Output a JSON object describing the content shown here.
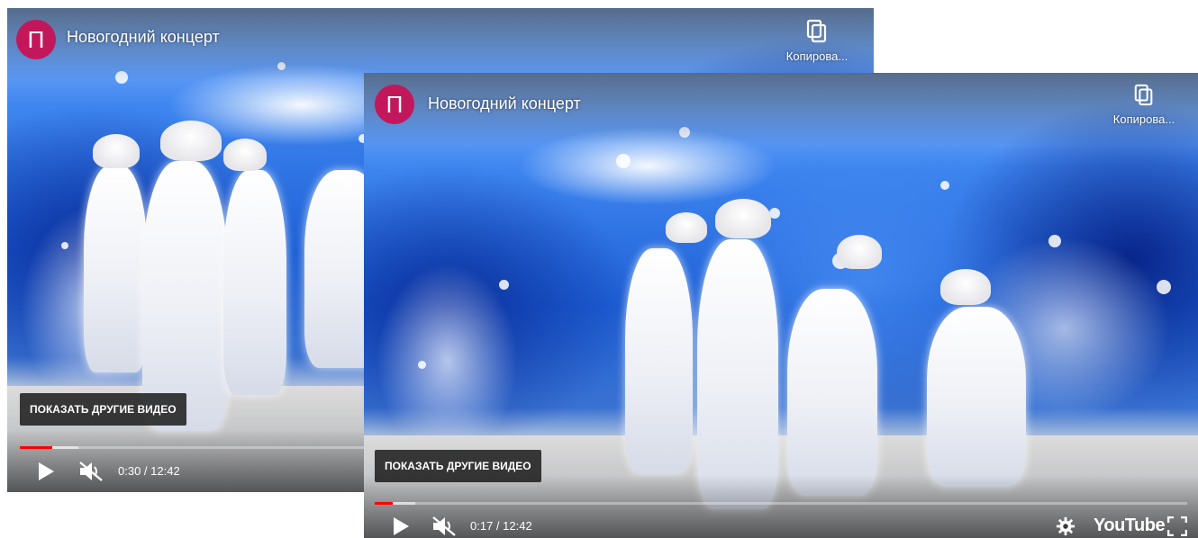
{
  "players": [
    {
      "channel_initial": "П",
      "title": "Новогодний концерт",
      "copy_label": "Копирова...",
      "more_videos_label": "ПОКАЗАТЬ ДРУГИЕ ВИДЕО",
      "time": "0:30 / 12:42",
      "progress_fraction": 0.039,
      "loaded_fraction": 0.07,
      "icons": [
        "copy-icon",
        "play-icon",
        "mute-icon"
      ]
    },
    {
      "channel_initial": "П",
      "title": "Новогодний концерт",
      "copy_label": "Копирова...",
      "more_videos_label": "ПОКАЗАТЬ ДРУГИЕ ВИДЕО",
      "time": "0:17 / 12:42",
      "progress_fraction": 0.022,
      "loaded_fraction": 0.05,
      "youtube_label": "YouTube",
      "icons": [
        "copy-icon",
        "play-icon",
        "mute-icon",
        "settings-gear-icon",
        "youtube-logo",
        "fullscreen-icon"
      ]
    }
  ],
  "colors": {
    "avatar": "#c2185b",
    "progress_played": "#ff0000",
    "controls": "#ffffff"
  }
}
